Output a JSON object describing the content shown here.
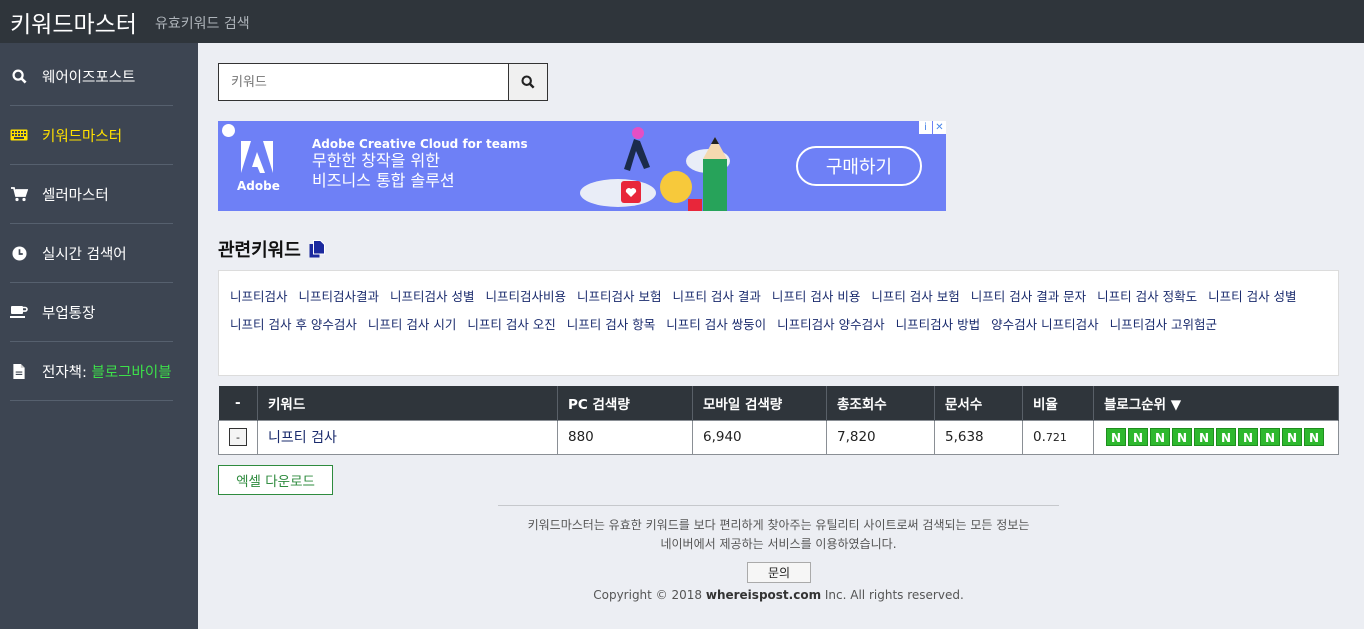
{
  "header": {
    "brand": "키워드마스터",
    "subtitle": "유효키워드 검색"
  },
  "sidebar": {
    "items": [
      {
        "label": "웨어이즈포스트",
        "icon": "search-icon"
      },
      {
        "label": "키워드마스터",
        "icon": "keyboard-icon"
      },
      {
        "label": "셀러마스터",
        "icon": "cart-icon"
      },
      {
        "label": "실시간 검색어",
        "icon": "clock-icon"
      },
      {
        "label": "부업통장",
        "icon": "coffee-icon"
      },
      {
        "label": "전자책: ",
        "label_highlight": "블로그바이블",
        "icon": "file-icon"
      }
    ]
  },
  "search": {
    "value": "",
    "placeholder": "키워드"
  },
  "ad": {
    "brand": "Adobe",
    "headline": "Adobe Creative Cloud for teams",
    "line1": "무한한 창작을 위한",
    "line2": "비즈니스 통합 솔루션",
    "cta": "구매하기"
  },
  "related": {
    "title": "관련키워드",
    "keywords": [
      "니프티검사",
      "니프티검사결과",
      "니프티검사 성별",
      "니프티검사비용",
      "니프티검사 보험",
      "니프티 검사 결과",
      "니프티 검사 비용",
      "니프티 검사 보험",
      "니프티 검사 결과 문자",
      "니프티 검사 정확도",
      "니프티 검사 성별",
      "니프티 검사 후 양수검사",
      "니프티 검사 시기",
      "니프티 검사 오진",
      "니프티 검사 항목",
      "니프티 검사 쌍둥이",
      "니프티검사 양수검사",
      "니프티검사 방법",
      "양수검사 니프티검사",
      "니프티검사 고위험군"
    ]
  },
  "table": {
    "headers": [
      "-",
      "키워드",
      "PC 검색량",
      "모바일 검색량",
      "총조회수",
      "문서수",
      "비율",
      "블로그순위 ▼"
    ],
    "rows": [
      {
        "minus": "-",
        "keyword": "니프티 검사",
        "pc": "880",
        "mobile": "6,940",
        "total": "7,820",
        "docs": "5,638",
        "ratio_main": "0.",
        "ratio_sub": "721",
        "ranks": [
          "N",
          "N",
          "N",
          "N",
          "N",
          "N",
          "N",
          "N",
          "N",
          "N"
        ]
      }
    ]
  },
  "excel_button": "엑셀 다운로드",
  "footer": {
    "line1": "키워드마스터는 유효한 키워드를 보다 편리하게 찾아주는 유틸리티 사이트로써 검색되는 모든 정보는",
    "line2": "네이버에서 제공하는 서비스를 이용하였습니다.",
    "contact": "문의",
    "copyright_pre": "Copyright © 2018 ",
    "copyright_site": "whereispost.com",
    "copyright_post": " Inc. All rights reserved."
  },
  "colors": {
    "topbar": "#2f353b",
    "sidebar": "#3d4552",
    "active": "#ffe100",
    "highlight": "#3de04a",
    "rank": "#2eb82e",
    "ad": "#6e80f6"
  }
}
